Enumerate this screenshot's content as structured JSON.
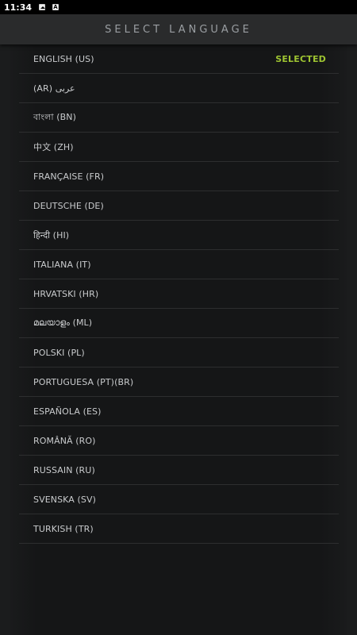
{
  "status_bar": {
    "time": "11:34",
    "icons": [
      "image-notification-icon",
      "a-notification-icon"
    ],
    "a_icon_text": "A"
  },
  "header": {
    "title": "SELECT LANGUAGE"
  },
  "colors": {
    "accent": "#9ec431",
    "background": "#1b1c1d",
    "header": "#2a2b2c"
  },
  "languages": [
    {
      "label": "ENGLISH (US)",
      "selected": true,
      "badge": "SELECTED"
    },
    {
      "label": "(AR) عربى"
    },
    {
      "label": "বাংলা (BN)"
    },
    {
      "label": "中文 (ZH)"
    },
    {
      "label": "FRANÇAISE (FR)"
    },
    {
      "label": "DEUTSCHE (DE)"
    },
    {
      "label": "हिन्दी (HI)"
    },
    {
      "label": "ITALIANA (IT)"
    },
    {
      "label": "HRVATSKI (HR)"
    },
    {
      "label": "മലയാളം (ML)"
    },
    {
      "label": "POLSKI (PL)"
    },
    {
      "label": "PORTUGUESA (PT)(BR)"
    },
    {
      "label": "ESPAÑOLA (ES)"
    },
    {
      "label": "ROMÂNĂ (RO)"
    },
    {
      "label": "RUSSAIN (RU)"
    },
    {
      "label": "SVENSKA (SV)"
    },
    {
      "label": "TURKISH (TR)"
    }
  ]
}
